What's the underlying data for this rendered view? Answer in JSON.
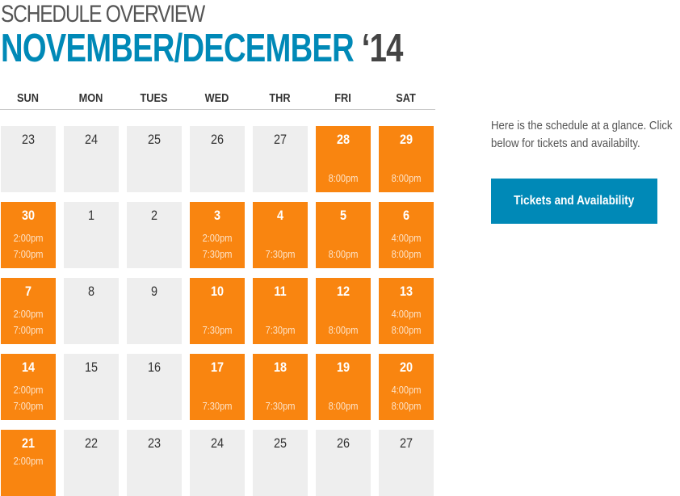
{
  "header": {
    "subtitle": "SCHEDULE OVERVIEW",
    "title": "NOVEMBER/DECEMBER",
    "year": "‘14"
  },
  "calendar": {
    "days_of_week": [
      "SUN",
      "MON",
      "TUES",
      "WED",
      "THR",
      "FRI",
      "SAT"
    ],
    "weeks": [
      [
        {
          "day": "23",
          "event": false,
          "times": []
        },
        {
          "day": "24",
          "event": false,
          "times": []
        },
        {
          "day": "25",
          "event": false,
          "times": []
        },
        {
          "day": "26",
          "event": false,
          "times": []
        },
        {
          "day": "27",
          "event": false,
          "times": []
        },
        {
          "day": "28",
          "event": true,
          "times": [
            "8:00pm"
          ]
        },
        {
          "day": "29",
          "event": true,
          "times": [
            "8:00pm"
          ]
        }
      ],
      [
        {
          "day": "30",
          "event": true,
          "times": [
            "2:00pm",
            "7:00pm"
          ]
        },
        {
          "day": "1",
          "event": false,
          "times": []
        },
        {
          "day": "2",
          "event": false,
          "times": []
        },
        {
          "day": "3",
          "event": true,
          "times": [
            "2:00pm",
            "7:30pm"
          ]
        },
        {
          "day": "4",
          "event": true,
          "times": [
            "7:30pm"
          ]
        },
        {
          "day": "5",
          "event": true,
          "times": [
            "8:00pm"
          ]
        },
        {
          "day": "6",
          "event": true,
          "times": [
            "4:00pm",
            "8:00pm"
          ]
        }
      ],
      [
        {
          "day": "7",
          "event": true,
          "times": [
            "2:00pm",
            "7:00pm"
          ]
        },
        {
          "day": "8",
          "event": false,
          "times": []
        },
        {
          "day": "9",
          "event": false,
          "times": []
        },
        {
          "day": "10",
          "event": true,
          "times": [
            "7:30pm"
          ]
        },
        {
          "day": "11",
          "event": true,
          "times": [
            "7:30pm"
          ]
        },
        {
          "day": "12",
          "event": true,
          "times": [
            "8:00pm"
          ]
        },
        {
          "day": "13",
          "event": true,
          "times": [
            "4:00pm",
            "8:00pm"
          ]
        }
      ],
      [
        {
          "day": "14",
          "event": true,
          "times": [
            "2:00pm",
            "7:00pm"
          ]
        },
        {
          "day": "15",
          "event": false,
          "times": []
        },
        {
          "day": "16",
          "event": false,
          "times": []
        },
        {
          "day": "17",
          "event": true,
          "times": [
            "7:30pm"
          ]
        },
        {
          "day": "18",
          "event": true,
          "times": [
            "7:30pm"
          ]
        },
        {
          "day": "19",
          "event": true,
          "times": [
            "8:00pm"
          ]
        },
        {
          "day": "20",
          "event": true,
          "times": [
            "4:00pm",
            "8:00pm"
          ]
        }
      ],
      [
        {
          "day": "21",
          "event": true,
          "times": [
            "2:00pm"
          ],
          "times_top": true
        },
        {
          "day": "22",
          "event": false,
          "times": []
        },
        {
          "day": "23",
          "event": false,
          "times": []
        },
        {
          "day": "24",
          "event": false,
          "times": []
        },
        {
          "day": "25",
          "event": false,
          "times": []
        },
        {
          "day": "26",
          "event": false,
          "times": []
        },
        {
          "day": "27",
          "event": false,
          "times": []
        }
      ]
    ]
  },
  "sidebar": {
    "description_line1": "Here is the schedule at a glance. Click",
    "description_line2": "below for tickets and availabilty.",
    "button_label": "Tickets and Availability"
  },
  "colors": {
    "brand_blue": "#0089b7",
    "event_orange": "#f98510",
    "empty_cell": "#eeeeee"
  }
}
